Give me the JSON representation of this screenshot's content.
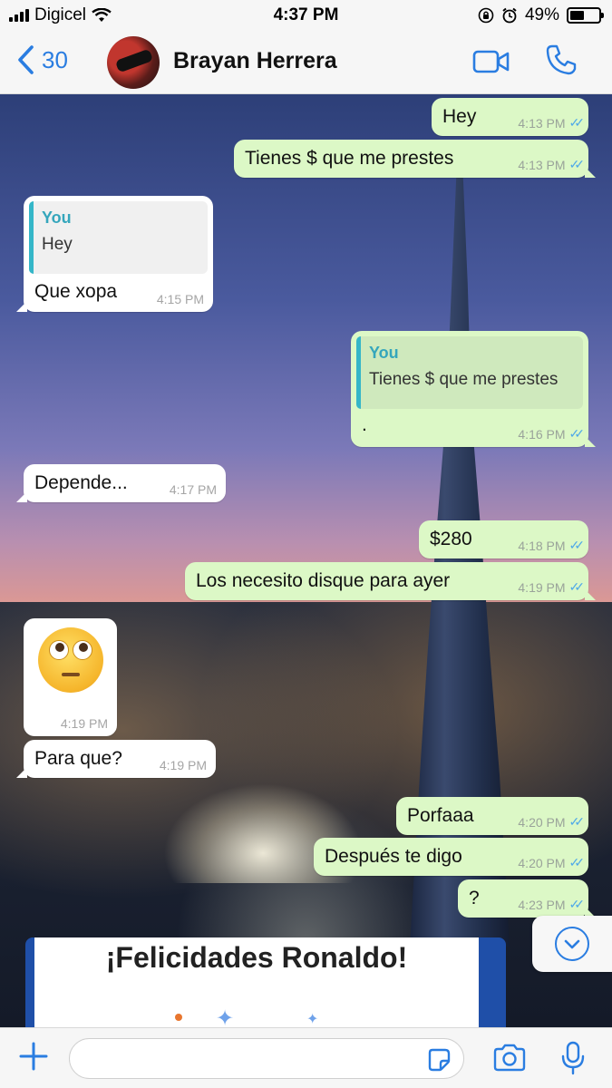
{
  "status_bar": {
    "carrier": "Digicel",
    "time": "4:37 PM",
    "battery": "49%",
    "battery_level": 0.49
  },
  "header": {
    "back_count": "30",
    "contact_name": "Brayan Herrera"
  },
  "messages": [
    {
      "text": "Hey",
      "time": "4:13 PM",
      "direction": "outgoing"
    },
    {
      "text": "Tienes $ que me prestes",
      "time": "4:13 PM",
      "direction": "outgoing"
    },
    {
      "text": "Que xopa",
      "time": "4:15 PM",
      "direction": "incoming",
      "quote": {
        "author": "You",
        "text": "Hey"
      }
    },
    {
      "text": ".",
      "time": "4:16 PM",
      "direction": "outgoing",
      "quote": {
        "author": "You",
        "text": "Tienes $ que me prestes"
      }
    },
    {
      "text": "Depende...",
      "time": "4:17 PM",
      "direction": "incoming"
    },
    {
      "text": "$280",
      "time": "4:18 PM",
      "direction": "outgoing"
    },
    {
      "text": "Los necesito disque para ayer",
      "time": "4:19 PM",
      "direction": "outgoing"
    },
    {
      "text": "",
      "emoji": "face-with-rolling-eyes",
      "time": "4:19 PM",
      "direction": "incoming"
    },
    {
      "text": "Para que?",
      "time": "4:19 PM",
      "direction": "incoming"
    },
    {
      "text": "Porfaaa",
      "time": "4:20 PM",
      "direction": "outgoing"
    },
    {
      "text": "Después te digo",
      "time": "4:20 PM",
      "direction": "outgoing"
    },
    {
      "text": "?",
      "time": "4:23 PM",
      "direction": "outgoing"
    }
  ],
  "banner": {
    "text": "¡Felicidades Ronaldo!"
  },
  "input": {
    "placeholder": ""
  },
  "colors": {
    "accent": "#2a7de1",
    "outgoing_bubble": "#dcf8c6",
    "incoming_bubble": "#ffffff",
    "read_ticks": "#4fa9e8"
  }
}
